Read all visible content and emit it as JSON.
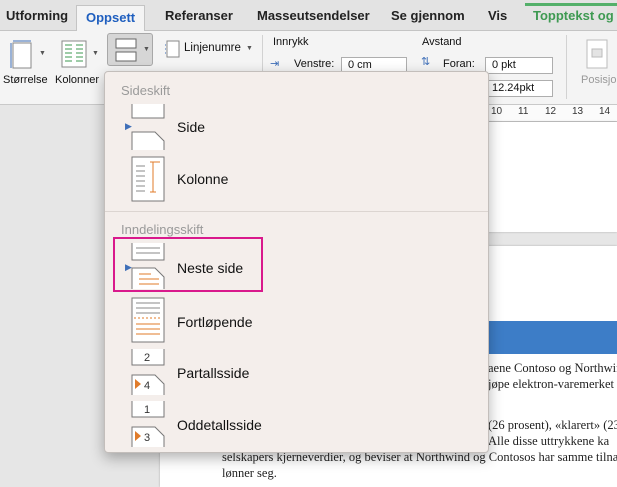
{
  "tabs": [
    "Utforming",
    "Oppsett",
    "Referanser",
    "Masseutsendelser",
    "Se gjennom",
    "Vis",
    "Topptekst og"
  ],
  "active_tab": "Oppsett",
  "ribbon": {
    "size_label": "Størrelse",
    "columns_label": "Kolonner",
    "line_numbers_label": "Linjenumre",
    "indent_group": "Innrykk",
    "left_label": "Venstre:",
    "left_value": "0 cm",
    "spacing_group": "Avstand",
    "before_label": "Foran:",
    "before_value": "0 pkt",
    "after_value": "12.24pkt",
    "position_label": "Posisjo"
  },
  "ruler_numbers": [
    "10",
    "11",
    "12",
    "13",
    "14"
  ],
  "document": {
    "lines": [
      "aene Contoso og Northwin",
      "jøpe elektron-varemerket f",
      "(26 prosent), «klarert» (23",
      "Alle disse uttrykkene ka",
      "selskapers kjerneverdier, og beviser at Northwind og Contosos har samme tilnær",
      "lønner seg."
    ]
  },
  "menu": {
    "section1": "Sideskift",
    "section2": "Inndelingsskift",
    "items": [
      {
        "label": "Side",
        "icon": "page-break-icon"
      },
      {
        "label": "Kolonne",
        "icon": "column-break-icon"
      },
      {
        "label": "Neste side",
        "icon": "next-page-break-icon"
      },
      {
        "label": "Fortløpende",
        "icon": "continuous-break-icon"
      },
      {
        "label": "Partallsside",
        "icon": "even-page-break-icon"
      },
      {
        "label": "Oddetallsside",
        "icon": "odd-page-break-icon"
      }
    ]
  },
  "colors": {
    "active_tab_text": "#1f5fbf",
    "context_tab": "#3e9a52",
    "highlight_border": "#d9198c",
    "document_banner": "#3d7dc7",
    "selection_marker": "#3f6fb8",
    "break_icon_accent": "#e07b2a"
  }
}
